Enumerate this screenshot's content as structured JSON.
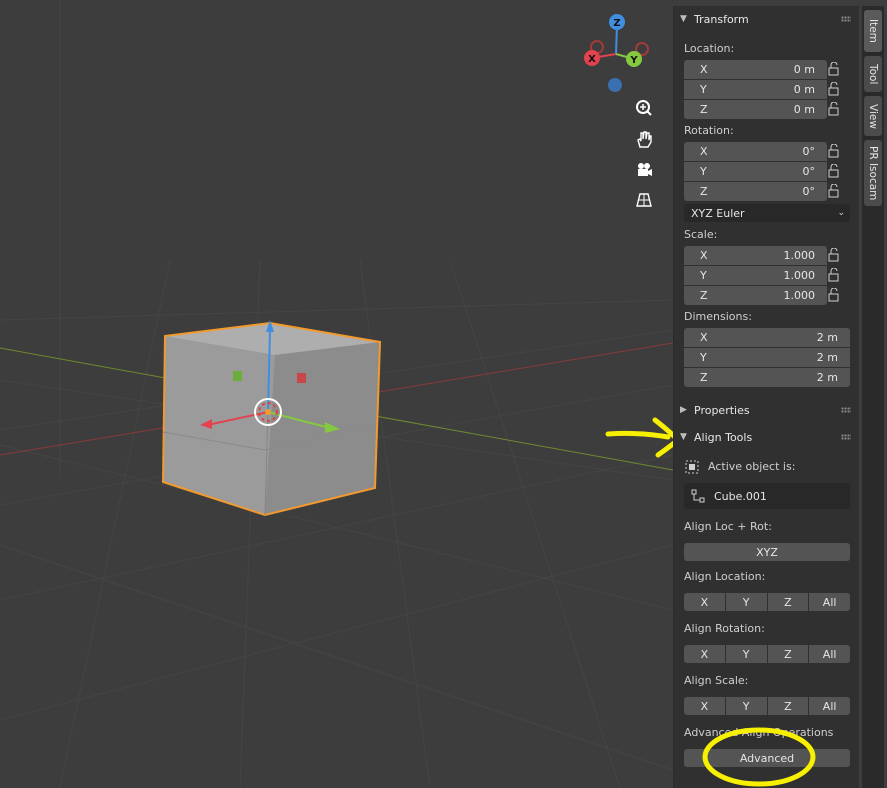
{
  "sidebar_tabs": [
    "Item",
    "Tool",
    "View",
    "PR Isocam"
  ],
  "transform": {
    "header": "Transform",
    "location_label": "Location:",
    "location": [
      {
        "axis": "X",
        "value": "0 m"
      },
      {
        "axis": "Y",
        "value": "0 m"
      },
      {
        "axis": "Z",
        "value": "0 m"
      }
    ],
    "rotation_label": "Rotation:",
    "rotation": [
      {
        "axis": "X",
        "value": "0°"
      },
      {
        "axis": "Y",
        "value": "0°"
      },
      {
        "axis": "Z",
        "value": "0°"
      }
    ],
    "rotation_mode": "XYZ Euler",
    "scale_label": "Scale:",
    "scale": [
      {
        "axis": "X",
        "value": "1.000"
      },
      {
        "axis": "Y",
        "value": "1.000"
      },
      {
        "axis": "Z",
        "value": "1.000"
      }
    ],
    "dimensions_label": "Dimensions:",
    "dimensions": [
      {
        "axis": "X",
        "value": "2 m"
      },
      {
        "axis": "Y",
        "value": "2 m"
      },
      {
        "axis": "Z",
        "value": "2 m"
      }
    ]
  },
  "properties": {
    "header": "Properties"
  },
  "align_tools": {
    "header": "Align Tools",
    "active_label": "Active object is:",
    "active_object": "Cube.001",
    "loc_rot_label": "Align Loc + Rot:",
    "loc_rot_button": "XYZ",
    "location_label": "Align Location:",
    "rotation_label": "Align Rotation:",
    "scale_label": "Align Scale:",
    "axis_buttons": [
      "X",
      "Y",
      "Z",
      "All"
    ],
    "advanced_label": "Advanced Align Operations",
    "advanced_button": "Advanced"
  },
  "gizmo": {
    "x": "X",
    "y": "Y",
    "z": "Z"
  },
  "colors": {
    "x_axis": "#e2434f",
    "y_axis": "#85c940",
    "z_axis": "#3f8ee2",
    "selection": "#f29a2e",
    "annotation": "#f7f000"
  },
  "icons": [
    "zoom-icon",
    "hand-pan-icon",
    "camera-icon",
    "perspective-grid-icon",
    "lock-icon"
  ]
}
